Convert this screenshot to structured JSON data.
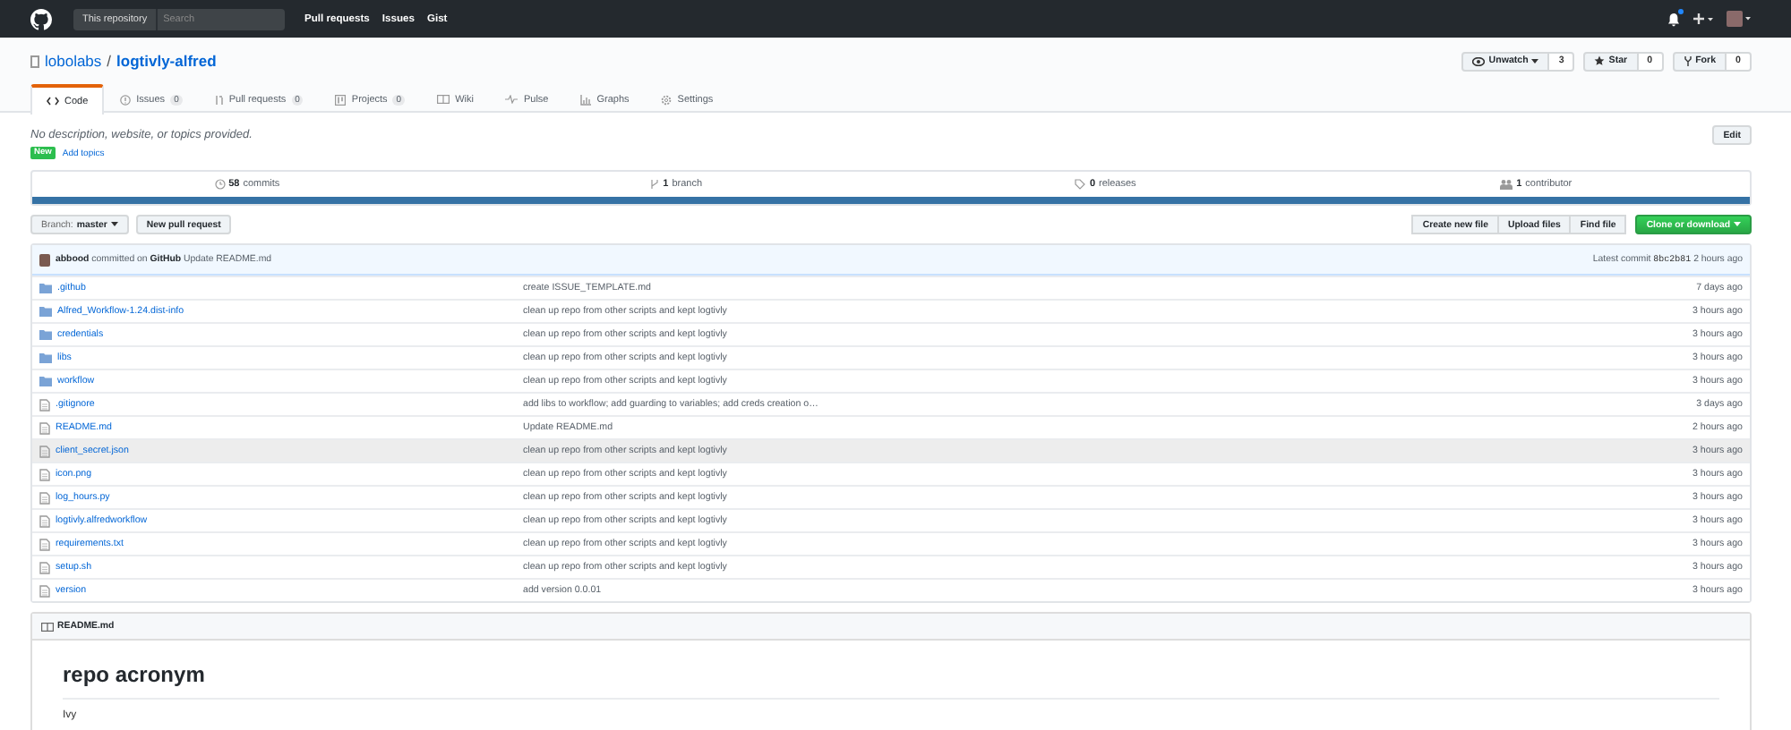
{
  "header": {
    "scope_label": "This repository",
    "search": {
      "placeholder": "Search"
    },
    "nav": [
      "Pull requests",
      "Issues",
      "Gist"
    ],
    "notification_unread": true
  },
  "repo": {
    "owner": "lobolabs",
    "separator": "/",
    "name": "logtivly-alfred",
    "actions": [
      {
        "label": "Unwatch",
        "count": "3",
        "kind": "watch"
      },
      {
        "label": "Star",
        "count": "0",
        "kind": "star"
      },
      {
        "label": "Fork",
        "count": "0",
        "kind": "fork"
      }
    ]
  },
  "tabs": [
    {
      "label": "Code",
      "kind": "code",
      "selected": true
    },
    {
      "label": "Issues",
      "count": "0",
      "kind": "issues",
      "selected": false
    },
    {
      "label": "Pull requests",
      "count": "0",
      "kind": "pr",
      "selected": false
    },
    {
      "label": "Projects",
      "count": "0",
      "kind": "projects",
      "selected": false
    },
    {
      "label": "Wiki",
      "kind": "wiki",
      "selected": false
    },
    {
      "label": "Pulse",
      "kind": "pulse",
      "selected": false
    },
    {
      "label": "Graphs",
      "kind": "graphs",
      "selected": false
    },
    {
      "label": "Settings",
      "kind": "settings",
      "selected": false
    }
  ],
  "description": "No description, website, or topics provided.",
  "edit_button": "Edit",
  "new_badge": "New",
  "add_topics": "Add topics",
  "summary": [
    {
      "kind": "commits",
      "count": "58",
      "label": "commits"
    },
    {
      "kind": "branch",
      "count": "1",
      "label": "branch"
    },
    {
      "kind": "releases",
      "count": "0",
      "label": "releases"
    },
    {
      "kind": "contributors",
      "count": "1",
      "label": "contributor"
    }
  ],
  "branch_button": {
    "label": "Branch:",
    "value": "master"
  },
  "new_pull_request": "New pull request",
  "file_buttons": [
    "Create new file",
    "Upload files",
    "Find file"
  ],
  "clone_button": "Clone or download",
  "commit": {
    "author": "abbood",
    "via": "committed on",
    "platform": "GitHub",
    "message": "Update README.md",
    "latest_label": "Latest commit",
    "sha": "8bc2b81",
    "time": "2 hours ago"
  },
  "files": [
    {
      "name": ".github",
      "kind": "folder",
      "message": "create ISSUE_TEMPLATE.md",
      "age": "7 days ago",
      "hovered": false
    },
    {
      "name": "Alfred_Workflow-1.24.dist-info",
      "kind": "folder",
      "message": "clean up repo from other scripts and kept logtivly",
      "age": "3 hours ago",
      "hovered": false
    },
    {
      "name": "credentials",
      "kind": "folder",
      "message": "clean up repo from other scripts and kept logtivly",
      "age": "3 hours ago",
      "hovered": false
    },
    {
      "name": "libs",
      "kind": "folder",
      "message": "clean up repo from other scripts and kept logtivly",
      "age": "3 hours ago",
      "hovered": false
    },
    {
      "name": "workflow",
      "kind": "folder",
      "message": "clean up repo from other scripts and kept logtivly",
      "age": "3 hours ago",
      "hovered": false
    },
    {
      "name": ".gitignore",
      "kind": "file",
      "message": "add libs to workflow; add guarding to variables; add creds creation o…",
      "age": "3 days ago",
      "hovered": false
    },
    {
      "name": "README.md",
      "kind": "file",
      "message": "Update README.md",
      "age": "2 hours ago",
      "hovered": false
    },
    {
      "name": "client_secret.json",
      "kind": "file",
      "message": "clean up repo from other scripts and kept logtivly",
      "age": "3 hours ago",
      "hovered": true
    },
    {
      "name": "icon.png",
      "kind": "file",
      "message": "clean up repo from other scripts and kept logtivly",
      "age": "3 hours ago",
      "hovered": false
    },
    {
      "name": "log_hours.py",
      "kind": "file",
      "message": "clean up repo from other scripts and kept logtivly",
      "age": "3 hours ago",
      "hovered": false
    },
    {
      "name": "logtivly.alfredworkflow",
      "kind": "file",
      "message": "clean up repo from other scripts and kept logtivly",
      "age": "3 hours ago",
      "hovered": false
    },
    {
      "name": "requirements.txt",
      "kind": "file",
      "message": "clean up repo from other scripts and kept logtivly",
      "age": "3 hours ago",
      "hovered": false
    },
    {
      "name": "setup.sh",
      "kind": "file",
      "message": "clean up repo from other scripts and kept logtivly",
      "age": "3 hours ago",
      "hovered": false
    },
    {
      "name": "version",
      "kind": "file",
      "message": "add version 0.0.01",
      "age": "3 hours ago",
      "hovered": false
    }
  ],
  "readme": {
    "filename": "README.md",
    "heading": "repo acronym",
    "body": "Ivy"
  }
}
